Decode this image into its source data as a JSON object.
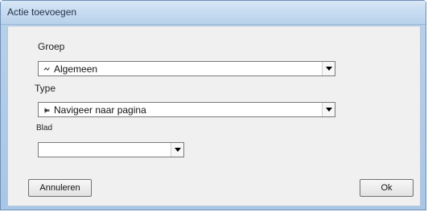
{
  "window": {
    "title": "Actie toevoegen"
  },
  "form": {
    "group": {
      "label": "Groep",
      "selected": "Algemeen",
      "icon": "flow-icon"
    },
    "type": {
      "label": "Type",
      "selected": "Navigeer naar pagina",
      "icon": "navigate-icon"
    },
    "sheet": {
      "label": "Blad",
      "selected": ""
    }
  },
  "buttons": {
    "cancel": "Annuleren",
    "ok": "Ok"
  }
}
